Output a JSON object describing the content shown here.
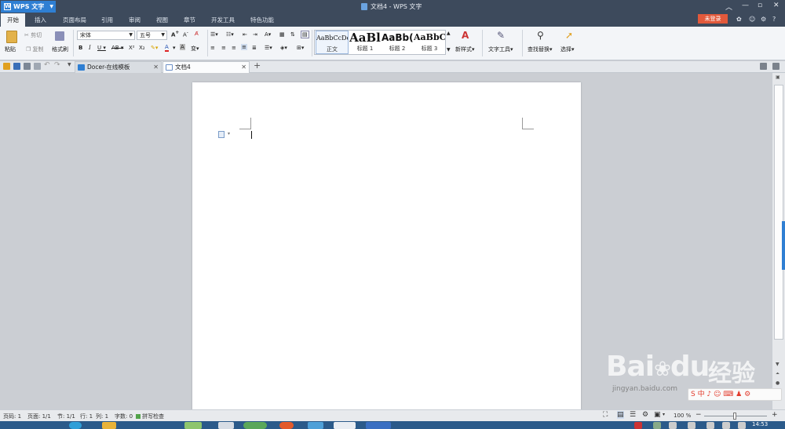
{
  "app": {
    "name": "WPS 文字",
    "window_title": "文档4 - WPS 文字"
  },
  "menu": [
    "开始",
    "插入",
    "页面布局",
    "引用",
    "审阅",
    "视图",
    "章节",
    "开发工具",
    "特色功能"
  ],
  "login_label": "未登录",
  "ribbon": {
    "paste": "粘贴",
    "cut": "剪切",
    "copy": "复制",
    "format_painter": "格式刷",
    "font_name": "宋体",
    "font_size": "五号",
    "styles": [
      {
        "sample": "AaBbCcDd",
        "name": "正文"
      },
      {
        "sample": "AaBl",
        "name": "标题 1"
      },
      {
        "sample": "AaBb(",
        "name": "标题 2"
      },
      {
        "sample": "AaBbC",
        "name": "标题 3"
      }
    ],
    "new_style": "新样式",
    "text_tools": "文字工具",
    "find_replace": "查找替换",
    "select": "选择"
  },
  "tabs": [
    {
      "label": "Docer-在线模板",
      "active": false
    },
    {
      "label": "文档4",
      "active": true
    }
  ],
  "status": {
    "page_num": "页码: 1",
    "pages": "页面: 1/1",
    "section": "节: 1/1",
    "line": "行: 1",
    "col": "列: 1",
    "words": "字数: 0",
    "spell": "拼写检查",
    "zoom": "100 %"
  },
  "taskbar": {
    "clock": "14:53"
  },
  "watermark": {
    "brand": "Bai",
    "brand2": "du",
    "cn": "经验",
    "url": "jingyan.baidu.com"
  },
  "colors": {
    "accent": "#2f7fd3",
    "titlebar": "#3d4a5c",
    "login": "#e2593b"
  }
}
